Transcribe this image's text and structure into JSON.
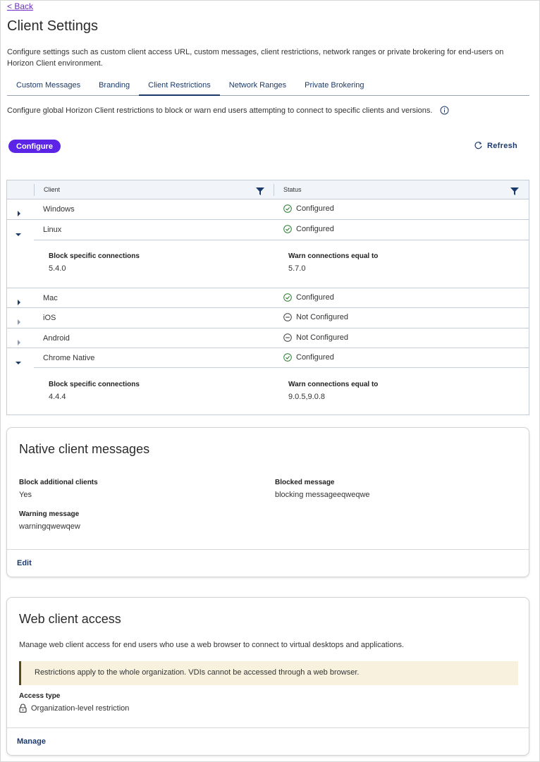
{
  "nav": {
    "back_label": "< Back"
  },
  "page": {
    "title": "Client Settings",
    "description": "Configure settings such as custom client access URL, custom messages, client restrictions, network ranges or private brokering for end-users on Horizon Client environment."
  },
  "tabs": [
    {
      "label": "Custom Messages"
    },
    {
      "label": "Branding"
    },
    {
      "label": "Client Restrictions",
      "active": true
    },
    {
      "label": "Network Ranges"
    },
    {
      "label": "Private Brokering"
    }
  ],
  "restrictions": {
    "description": "Configure global Horizon Client restrictions to block or warn end users attempting to connect to specific clients and versions.",
    "configure_label": "Configure",
    "refresh_label": "Refresh"
  },
  "table": {
    "headers": {
      "client": "Client",
      "status": "Status"
    },
    "rows": [
      {
        "client": "Windows",
        "status": "Configured",
        "expanded": false
      },
      {
        "client": "Linux",
        "status": "Configured",
        "expanded": true,
        "detail": {
          "block_label": "Block specific connections",
          "block_value": "5.4.0",
          "warn_label": "Warn connections equal to",
          "warn_value": "5.7.0"
        }
      },
      {
        "client": "Mac",
        "status": "Configured",
        "expanded": false
      },
      {
        "client": "iOS",
        "status": "Not Configured",
        "expanded": false
      },
      {
        "client": "Android",
        "status": "Not Configured",
        "expanded": false
      },
      {
        "client": "Chrome Native",
        "status": "Configured",
        "expanded": true,
        "detail": {
          "block_label": "Block specific connections",
          "block_value": "4.4.4",
          "warn_label": "Warn connections equal to",
          "warn_value": "9.0.5,9.0.8"
        }
      }
    ]
  },
  "native_messages": {
    "title": "Native client messages",
    "block_additional_label": "Block additional clients",
    "block_additional_value": "Yes",
    "blocked_message_label": "Blocked message",
    "blocked_message_value": "blocking messageeqweqwe",
    "warning_message_label": "Warning message",
    "warning_message_value": "warningqwewqew",
    "edit_label": "Edit"
  },
  "web_access": {
    "title": "Web client access",
    "description": "Manage web client access for end users who use a web browser to connect to virtual desktops and applications.",
    "banner": "Restrictions apply to the whole organization. VDIs cannot be accessed through a web browser.",
    "access_type_label": "Access type",
    "access_type_value": "Organization-level restriction",
    "manage_label": "Manage"
  },
  "colors": {
    "accent": "#5b24e6",
    "link": "#1b3a6b",
    "configured": "#2e7d32",
    "banner_bg": "#f7f1de"
  }
}
